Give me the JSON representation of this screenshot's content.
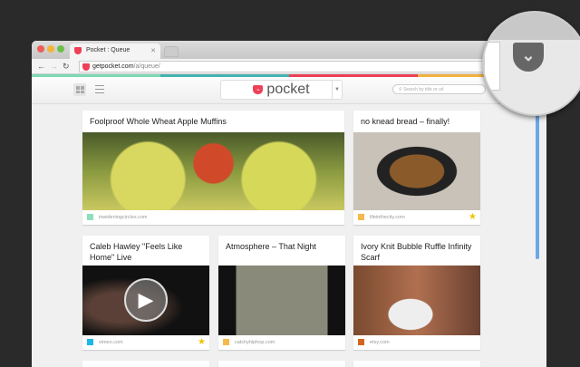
{
  "browser": {
    "tab_title": "Pocket : Queue",
    "url_domain": "getpocket.com",
    "url_path": "/a/queue/"
  },
  "header": {
    "logo_text": "pocket",
    "search_placeholder": "Search by title or url"
  },
  "stripe_colors": [
    "#7dd9b5",
    "#45b3af",
    "#ee4056",
    "#f3b23f"
  ],
  "cards": [
    {
      "title": "Foolproof Whole Wheat Apple Muffins",
      "source": "inwideningcircles.com",
      "source_color": "#8fe0bf",
      "starred": false,
      "image": "apples"
    },
    {
      "title": "no knead bread – finally!",
      "source": "lifeinthecity.com",
      "source_color": "#f6b94c",
      "starred": true,
      "image": "bread"
    },
    {
      "title": "Caleb Hawley \"Feels Like Home\" Live",
      "source": "vimeo.com",
      "source_color": "#1ab7ea",
      "starred": true,
      "image": "video"
    },
    {
      "title": "Atmosphere – That Night",
      "source": "catchyhiphop.com",
      "source_color": "#f6b94c",
      "starred": false,
      "image": "album"
    },
    {
      "title": "Ivory Knit Bubble Ruffle Infinity Scarf",
      "source": "etsy.com",
      "source_color": "#d5641c",
      "starred": false,
      "image": "scarf"
    }
  ]
}
